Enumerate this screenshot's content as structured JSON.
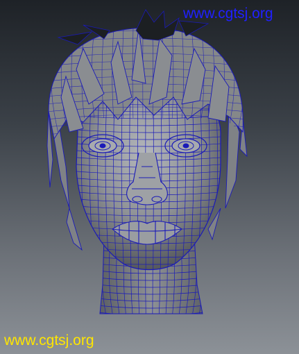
{
  "watermarks": {
    "top": {
      "text": "www.cgtsj.org",
      "color": "#2020ff"
    },
    "bottom": {
      "text": "www.cgtsj.org",
      "color": "#ffe600"
    }
  },
  "model": {
    "wireframe_color": "#1a1ab8",
    "surface_color": "#8f9296"
  }
}
